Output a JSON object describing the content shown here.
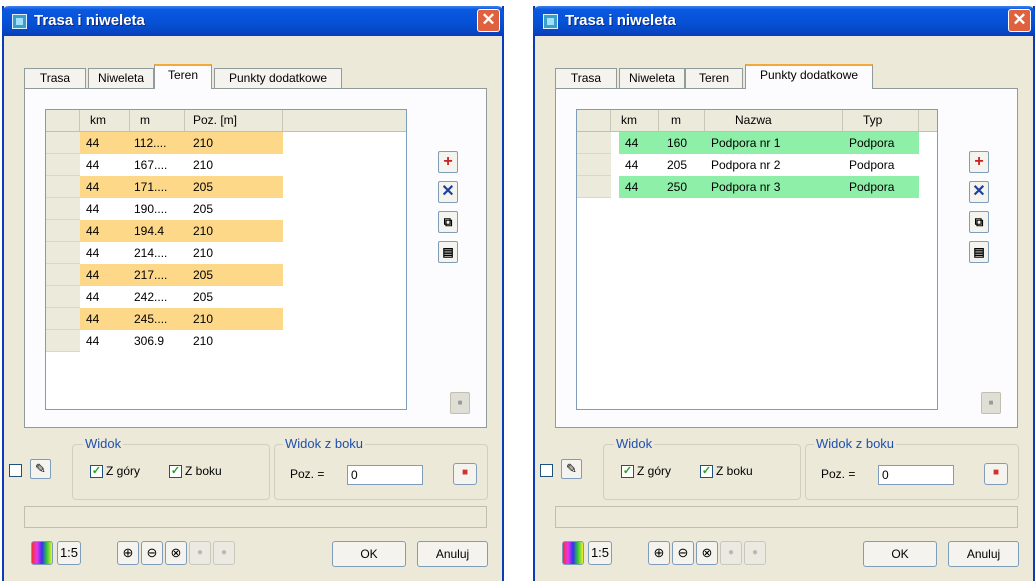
{
  "colors": {
    "row_highlight_left": "#fdd889",
    "row_highlight_right": "#8ef0a8",
    "title_blue": "#0653d8",
    "group_label": "#1f4fb0"
  },
  "icons": {
    "add": "plus-icon",
    "delete": "cross-icon",
    "copy": "copy-icon",
    "paste": "paste-icon",
    "edit": "pencil-icon",
    "grid_color": "color-grid-icon",
    "zoom_in": "zoom-in-icon",
    "zoom_out": "zoom-out-icon",
    "zoom_fit": "zoom-fit-icon"
  },
  "windows": [
    {
      "title": "Trasa i niweleta",
      "close": "✕",
      "tabs": [
        {
          "label": "Trasa"
        },
        {
          "label": "Niweleta"
        },
        {
          "label": "Teren"
        },
        {
          "label": "Punkty dodatkowe"
        }
      ],
      "active_tab": "Teren",
      "table": {
        "columns": [
          "km",
          "m",
          "Poz. [m]"
        ],
        "rows": [
          [
            "44",
            "112....",
            "210"
          ],
          [
            "44",
            "167....",
            "210"
          ],
          [
            "44",
            "171....",
            "205"
          ],
          [
            "44",
            "190....",
            "205"
          ],
          [
            "44",
            "194.4",
            "210"
          ],
          [
            "44",
            "214....",
            "210"
          ],
          [
            "44",
            "217....",
            "205"
          ],
          [
            "44",
            "242....",
            "205"
          ],
          [
            "44",
            "245....",
            "210"
          ],
          [
            "44",
            "306.9",
            "210"
          ]
        ]
      },
      "widok": {
        "label": "Widok",
        "z_gory": "Z góry",
        "z_boku": "Z boku"
      },
      "widok_z_boku": {
        "label": "Widok z boku",
        "poz_label": "Poz. =",
        "poz_value": "0"
      },
      "footer": {
        "scale": "1:5",
        "ok": "OK",
        "cancel": "Anuluj"
      }
    },
    {
      "title": "Trasa i niweleta",
      "close": "✕",
      "tabs": [
        {
          "label": "Trasa"
        },
        {
          "label": "Niweleta"
        },
        {
          "label": "Teren"
        },
        {
          "label": "Punkty dodatkowe"
        }
      ],
      "active_tab": "Punkty dodatkowe",
      "table": {
        "columns": [
          "km",
          "m",
          "Nazwa",
          "Typ"
        ],
        "rows": [
          [
            "44",
            "160",
            "Podpora nr 1",
            "Podpora"
          ],
          [
            "44",
            "205",
            "Podpora nr 2",
            "Podpora"
          ],
          [
            "44",
            "250",
            "Podpora nr 3",
            "Podpora"
          ]
        ]
      },
      "widok": {
        "label": "Widok",
        "z_gory": "Z góry",
        "z_boku": "Z boku"
      },
      "widok_z_boku": {
        "label": "Widok z boku",
        "poz_label": "Poz. =",
        "poz_value": "0"
      },
      "footer": {
        "scale": "1:5",
        "ok": "OK",
        "cancel": "Anuluj"
      }
    }
  ]
}
